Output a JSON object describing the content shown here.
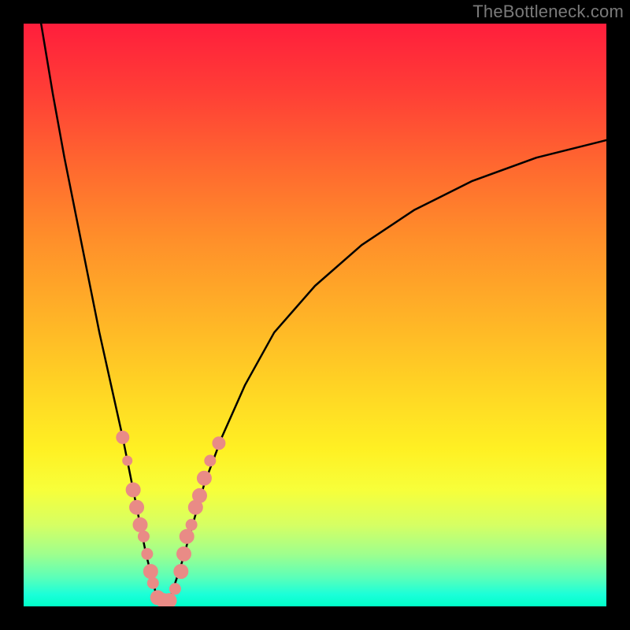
{
  "watermark": "TheBottleneck.com",
  "colors": {
    "background": "#000000",
    "curve": "#000000",
    "dot_fill": "#e98b86",
    "dot_stroke": "#e98b86"
  },
  "chart_data": {
    "type": "line",
    "title": "",
    "xlabel": "",
    "ylabel": "",
    "xlim": [
      0,
      100
    ],
    "ylim": [
      0,
      100
    ],
    "series": [
      {
        "name": "left-branch",
        "x": [
          3,
          5,
          7,
          9,
          11,
          13,
          15,
          17,
          18,
          19,
          20,
          21,
          22,
          23
        ],
        "y": [
          100,
          88,
          77,
          67,
          57,
          47,
          38,
          29,
          24,
          19,
          14,
          9,
          5,
          1
        ]
      },
      {
        "name": "right-branch",
        "x": [
          25,
          27,
          29,
          31,
          34,
          38,
          43,
          50,
          58,
          67,
          77,
          88,
          100
        ],
        "y": [
          1,
          7,
          14,
          21,
          29,
          38,
          47,
          55,
          62,
          68,
          73,
          77,
          80
        ]
      }
    ],
    "markers": [
      {
        "x": 17.0,
        "y": 29,
        "r": 8
      },
      {
        "x": 17.8,
        "y": 25,
        "r": 6
      },
      {
        "x": 18.8,
        "y": 20,
        "r": 9
      },
      {
        "x": 19.4,
        "y": 17,
        "r": 9
      },
      {
        "x": 20.0,
        "y": 14,
        "r": 9
      },
      {
        "x": 20.6,
        "y": 12,
        "r": 7
      },
      {
        "x": 21.2,
        "y": 9,
        "r": 7
      },
      {
        "x": 21.8,
        "y": 6,
        "r": 9
      },
      {
        "x": 22.2,
        "y": 4,
        "r": 7
      },
      {
        "x": 23.0,
        "y": 1.5,
        "r": 9
      },
      {
        "x": 24.0,
        "y": 1,
        "r": 9
      },
      {
        "x": 25.0,
        "y": 1,
        "r": 9
      },
      {
        "x": 26.0,
        "y": 3,
        "r": 7
      },
      {
        "x": 27.0,
        "y": 6,
        "r": 9
      },
      {
        "x": 27.5,
        "y": 9,
        "r": 9
      },
      {
        "x": 28.0,
        "y": 12,
        "r": 9
      },
      {
        "x": 28.8,
        "y": 14,
        "r": 7
      },
      {
        "x": 29.5,
        "y": 17,
        "r": 9
      },
      {
        "x": 30.2,
        "y": 19,
        "r": 9
      },
      {
        "x": 31.0,
        "y": 22,
        "r": 9
      },
      {
        "x": 32.0,
        "y": 25,
        "r": 7
      },
      {
        "x": 33.5,
        "y": 28,
        "r": 8
      }
    ]
  }
}
